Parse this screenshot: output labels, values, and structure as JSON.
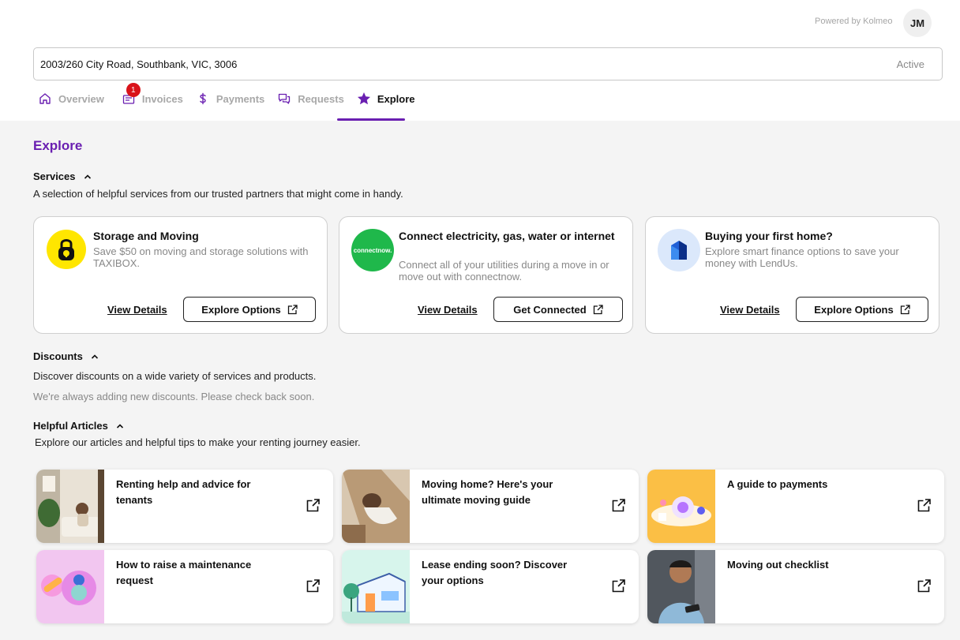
{
  "header": {
    "powered_by": "Powered by Kolmeo",
    "avatar_initials": "JM",
    "address": "2003/260 City Road, Southbank, VIC, 3006",
    "status": "Active"
  },
  "tabs": [
    {
      "label": "Overview",
      "icon": "home-icon"
    },
    {
      "label": "Invoices",
      "icon": "invoice-icon",
      "badge": "1"
    },
    {
      "label": "Payments",
      "icon": "dollar-icon"
    },
    {
      "label": "Requests",
      "icon": "chat-icon"
    },
    {
      "label": "Explore",
      "icon": "star-icon",
      "active": true
    }
  ],
  "page_title": "Explore",
  "services": {
    "heading": "Services",
    "description": "A selection of helpful services from our trusted partners that might come in handy.",
    "cards": [
      {
        "title": "Storage and Moving",
        "description": "Save $50 on moving and storage solutions with TAXIBOX.",
        "link": "View Details",
        "button": "Explore Options",
        "logo": "padlock-icon"
      },
      {
        "title": "Connect electricity, gas, water or internet",
        "description": "Connect all of your utilities during a move in or move out with connectnow.",
        "link": "View Details",
        "button": "Get Connected",
        "logo": "connectnow-logo",
        "logo_text": "connectnow."
      },
      {
        "title": "Buying your first home?",
        "description": "Explore smart finance options to save your money with LendUs.",
        "link": "View Details",
        "button": "Explore Options",
        "logo": "lendus-logo"
      }
    ]
  },
  "discounts": {
    "heading": "Discounts",
    "description": "Discover discounts on a wide variety of services and products.",
    "note": "We're always adding new discounts. Please check back soon."
  },
  "articles": {
    "heading": "Helpful Articles",
    "description": "Explore our articles and helpful tips to make your renting journey easier.",
    "items": [
      {
        "title": "Renting help and advice for tenants"
      },
      {
        "title": "Moving home? Here's your ultimate moving guide"
      },
      {
        "title": "A guide to payments"
      },
      {
        "title": "How to raise a maintenance request"
      },
      {
        "title": "Lease ending soon? Discover your options"
      },
      {
        "title": "Moving out checklist"
      }
    ]
  },
  "colors": {
    "accent": "#6a1fb1",
    "badge": "#d9131a"
  }
}
